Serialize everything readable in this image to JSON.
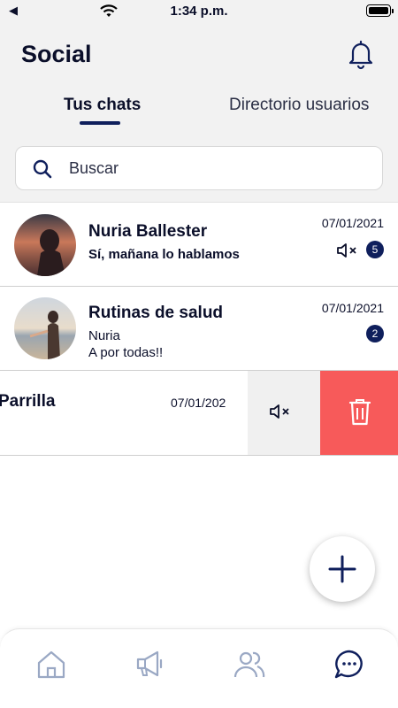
{
  "status_bar": {
    "time": "1:34 p.m."
  },
  "header": {
    "title": "Social",
    "tabs": [
      {
        "label": "Tus chats",
        "active": true
      },
      {
        "label": "Directorio usuarios",
        "active": false
      }
    ]
  },
  "search": {
    "placeholder": "Buscar"
  },
  "chats": [
    {
      "name": "Nuria Ballester",
      "last_message": "Sí, mañana lo hablamos",
      "date": "07/01/2021",
      "unread": "5",
      "muted": true
    },
    {
      "name": "Rutinas de salud",
      "sender": "Nuria",
      "last_message": "A por todas!!",
      "date": "07/01/2021",
      "unread": "2",
      "muted": false
    },
    {
      "name": "Parrilla",
      "date": "07/01/202",
      "swipe_actions": [
        "mute",
        "delete"
      ]
    }
  ],
  "bottom_nav": {
    "items": [
      {
        "icon": "home-icon"
      },
      {
        "icon": "megaphone-icon"
      },
      {
        "icon": "users-icon"
      },
      {
        "icon": "chat-icon",
        "active": true
      }
    ]
  },
  "colors": {
    "accent": "#0f1f5c",
    "delete": "#f75a5a",
    "header_bg": "#f2f2f2",
    "inactive_icon": "#9aa8c4"
  }
}
